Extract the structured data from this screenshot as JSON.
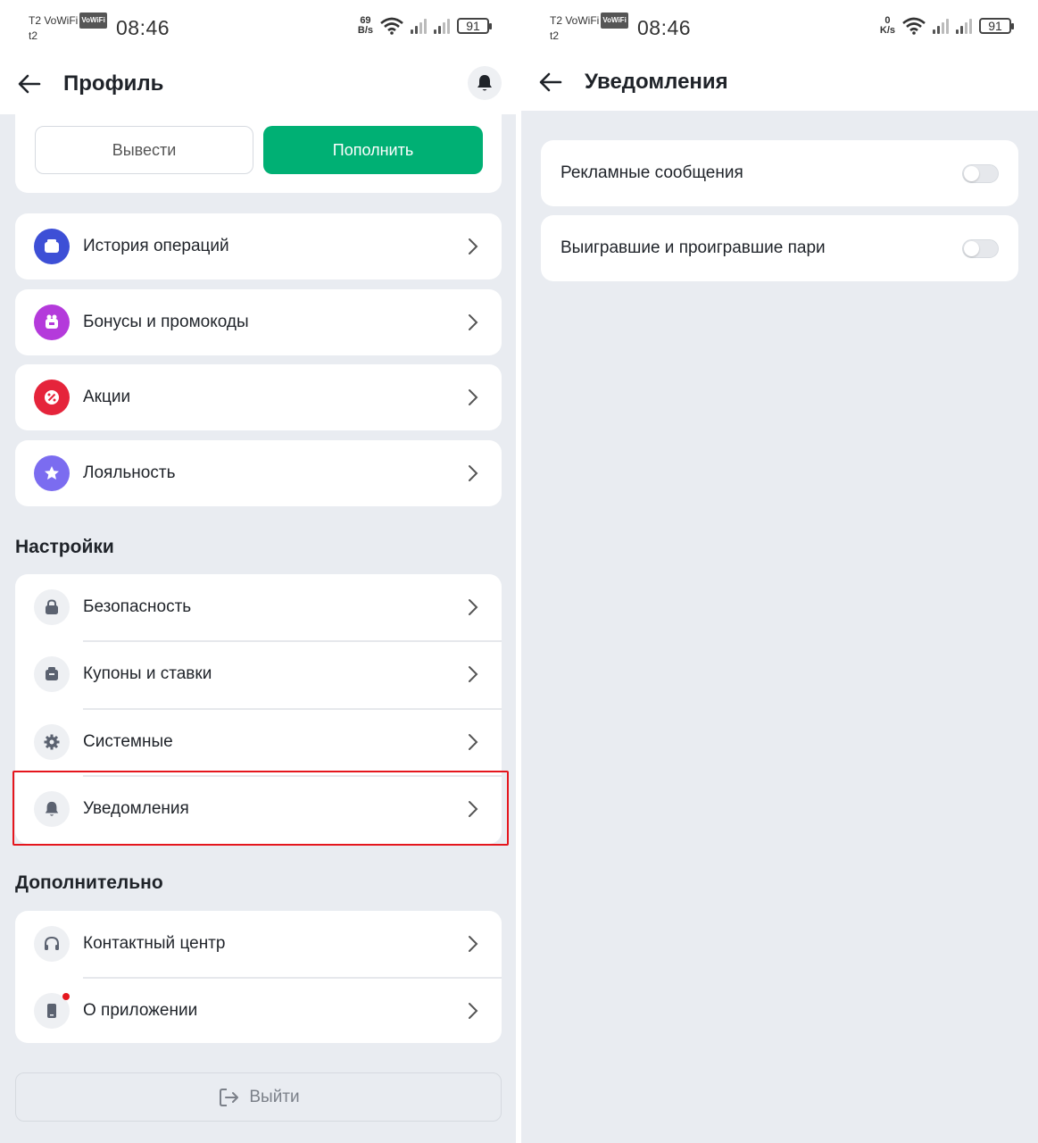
{
  "status_bar": {
    "carrier": "T2 VoWiFi",
    "volte_badge": "VoWiFi",
    "carrier_sub": "t2",
    "time": "08:46",
    "left_speed_value": "69",
    "left_speed_unit": "B/s",
    "right_speed_value": "0",
    "right_speed_unit": "K/s",
    "battery": "91"
  },
  "profile": {
    "title": "Профиль",
    "withdraw_label": "Вывести",
    "deposit_label": "Пополнить",
    "menu": [
      {
        "label": "История операций",
        "icon": "wallet-icon",
        "color": "#3d4fd6"
      },
      {
        "label": "Бонусы и промокоды",
        "icon": "gift-icon",
        "color": "#b43adb"
      },
      {
        "label": "Акции",
        "icon": "percent-badge-icon",
        "color": "#e5243b"
      },
      {
        "label": "Лояльность",
        "icon": "star-icon",
        "color": "#7b6cf0"
      }
    ],
    "settings_title": "Настройки",
    "settings": [
      {
        "label": "Безопасность",
        "icon": "lock-icon"
      },
      {
        "label": "Купоны и ставки",
        "icon": "coupon-icon"
      },
      {
        "label": "Системные",
        "icon": "gear-icon"
      },
      {
        "label": "Уведомления",
        "icon": "bell-icon"
      }
    ],
    "extra_title": "Дополнительно",
    "extra": [
      {
        "label": "Контактный центр",
        "icon": "headset-icon"
      },
      {
        "label": "О приложении",
        "icon": "phone-icon"
      }
    ],
    "logout_label": "Выйти"
  },
  "notifications": {
    "title": "Уведомления",
    "items": [
      {
        "label": "Рекламные сообщения",
        "enabled": false
      },
      {
        "label": "Выигравшие и проигравшие пари",
        "enabled": false
      }
    ]
  },
  "colors": {
    "accent_green": "#00b074",
    "highlight_red": "#e5161d",
    "background": "#e9ecf1"
  }
}
